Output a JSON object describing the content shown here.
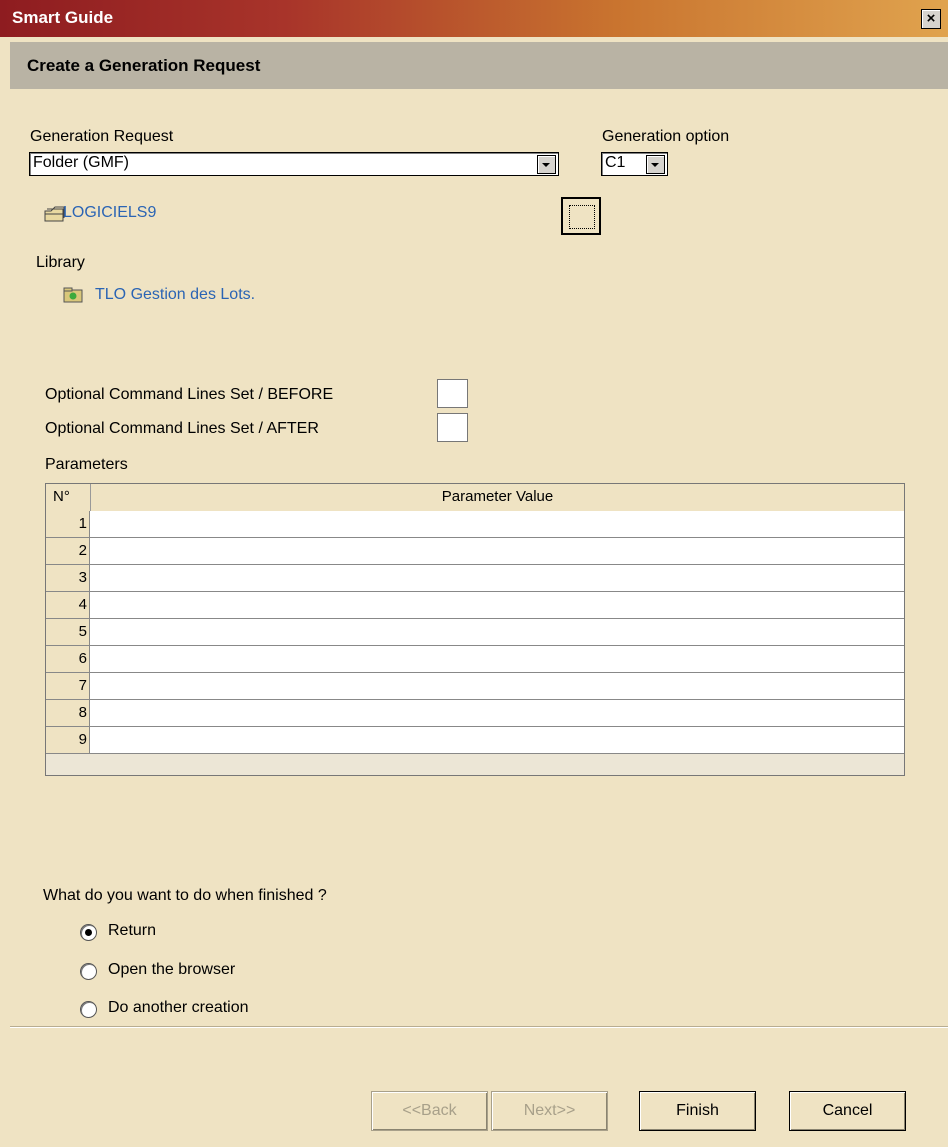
{
  "window": {
    "title": "Smart Guide",
    "close_glyph": "×"
  },
  "header": {
    "title": "Create a Generation Request"
  },
  "form": {
    "generation_request_label": "Generation Request",
    "generation_request_value": "Folder (GMF)",
    "generation_option_label": "Generation option",
    "generation_option_value": "C1",
    "folder_link": "LOGICIELS9",
    "library_label": "Library",
    "library_link": "TLO Gestion des Lots.",
    "cmd_before_label": "Optional Command Lines Set / BEFORE",
    "cmd_after_label": "Optional Command Lines Set / AFTER"
  },
  "parameters": {
    "label": "Parameters",
    "col_number": "N°",
    "col_value": "Parameter Value",
    "rows": [
      {
        "n": "1",
        "value": ""
      },
      {
        "n": "2",
        "value": ""
      },
      {
        "n": "3",
        "value": ""
      },
      {
        "n": "4",
        "value": ""
      },
      {
        "n": "5",
        "value": ""
      },
      {
        "n": "6",
        "value": ""
      },
      {
        "n": "7",
        "value": ""
      },
      {
        "n": "8",
        "value": ""
      },
      {
        "n": "9",
        "value": ""
      }
    ]
  },
  "finish_options": {
    "question": "What do you want to do when finished ?",
    "options": [
      {
        "label": "Return",
        "selected": true
      },
      {
        "label": "Open the browser",
        "selected": false
      },
      {
        "label": "Do another creation",
        "selected": false
      }
    ]
  },
  "buttons": {
    "back": "<<Back",
    "next": "Next>>",
    "finish": "Finish",
    "cancel": "Cancel"
  },
  "colors": {
    "background": "#efe3c3",
    "link": "#2a64b4",
    "header_band": "#b9b3a4"
  },
  "icons": [
    "close-icon",
    "folder-stack-icon",
    "library-folder-icon",
    "browse-icon",
    "dropdown-arrow-icon"
  ]
}
